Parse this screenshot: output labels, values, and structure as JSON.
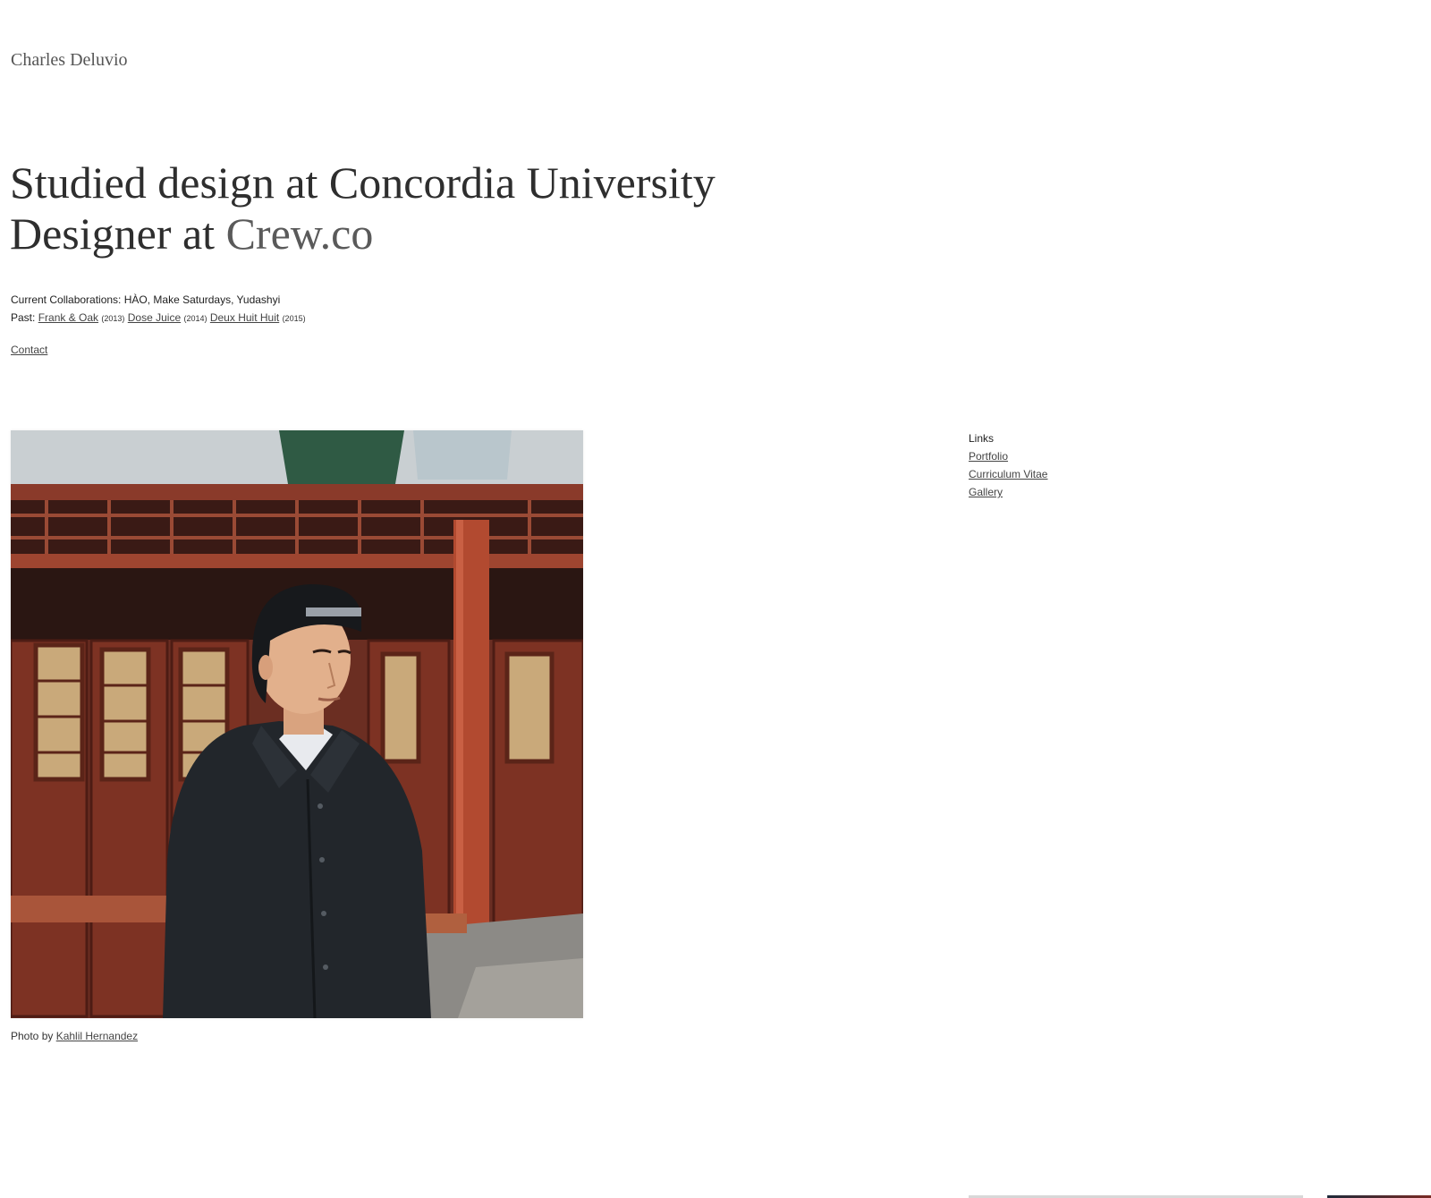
{
  "header": {
    "site_name": "Charles Deluvio"
  },
  "headline": {
    "line1": "Studied design at Concordia University",
    "line2_prefix": "Designer at ",
    "line2_link": "Crew.co"
  },
  "collaborations": {
    "current_label": "Current Collaborations: HÀO, Make Saturdays, Yudashyi",
    "past_label": "Past:",
    "past": [
      {
        "name": "Frank & Oak",
        "year": "(2013)"
      },
      {
        "name": "Dose Juice",
        "year": "(2014)"
      },
      {
        "name": "Deux Huit Huit",
        "year": "(2015)"
      }
    ]
  },
  "contact_label": "Contact",
  "photo": {
    "caption_prefix": "Photo by ",
    "credit_name": "Kahlil Hernandez"
  },
  "links": {
    "heading": "Links",
    "items": [
      "Portfolio",
      "Curriculum Vitae",
      "Gallery"
    ]
  }
}
